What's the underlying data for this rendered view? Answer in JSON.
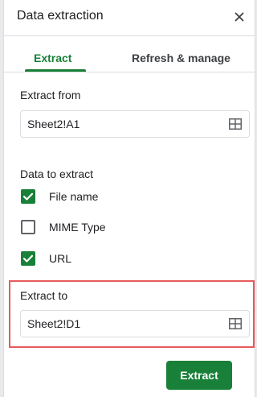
{
  "header": {
    "title": "Data extraction",
    "close_icon": "close-icon"
  },
  "tabs": [
    {
      "label": "Extract",
      "active": true
    },
    {
      "label": "Refresh & manage",
      "active": false
    }
  ],
  "extract_from": {
    "label": "Extract from",
    "value": "Sheet2!A1",
    "icon": "grid-select-icon"
  },
  "data_to_extract": {
    "label": "Data to extract",
    "options": [
      {
        "label": "File name",
        "checked": true
      },
      {
        "label": "MIME Type",
        "checked": false
      },
      {
        "label": "URL",
        "checked": true
      }
    ]
  },
  "extract_to": {
    "label": "Extract to",
    "value": "Sheet2!D1",
    "icon": "grid-select-icon"
  },
  "actions": {
    "extract_label": "Extract"
  },
  "colors": {
    "accent": "#188038",
    "highlight": "#e65b5b"
  }
}
